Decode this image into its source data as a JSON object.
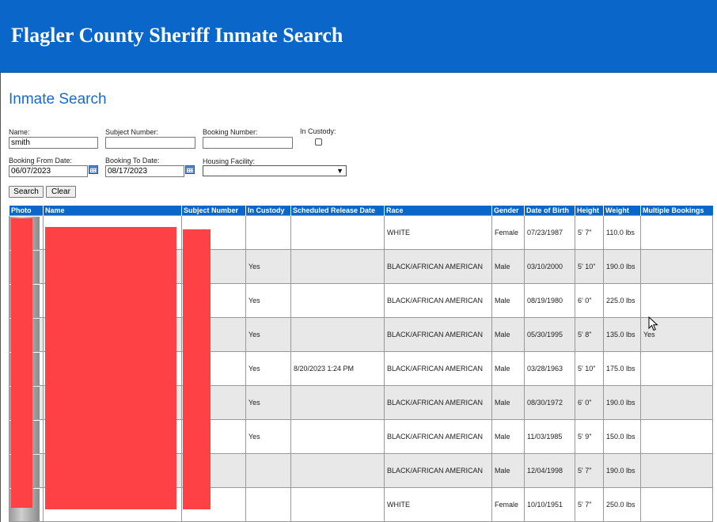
{
  "header": {
    "title": "Flagler County Sheriff Inmate Search"
  },
  "page_title": "Inmate Search",
  "form": {
    "name_label": "Name:",
    "name_value": "smith",
    "subject_label": "Subject Number:",
    "subject_value": "",
    "booking_label": "Booking Number:",
    "booking_value": "",
    "custody_label": "In Custody:",
    "from_label": "Booking From Date:",
    "from_value": "06/07/2023",
    "to_label": "Booking To Date:",
    "to_value": "08/17/2023",
    "housing_label": "Housing Facility:",
    "housing_value": "",
    "search_label": "Search",
    "clear_label": "Clear"
  },
  "table": {
    "columns": [
      "Photo",
      "Name",
      "Subject Number",
      "In Custody",
      "Scheduled Release Date",
      "Race",
      "Gender",
      "Date of Birth",
      "Height",
      "Weight",
      "Multiple Bookings"
    ],
    "rows": [
      {
        "custody": "",
        "release": "",
        "race": "WHITE",
        "gender": "Female",
        "dob": "07/23/1987",
        "height": "5' 7\"",
        "weight": "110.0 lbs",
        "multiple": ""
      },
      {
        "custody": "Yes",
        "release": "",
        "race": "BLACK/AFRICAN AMERICAN",
        "gender": "Male",
        "dob": "03/10/2000",
        "height": "5' 10\"",
        "weight": "190.0 lbs",
        "multiple": ""
      },
      {
        "custody": "Yes",
        "release": "",
        "race": "BLACK/AFRICAN AMERICAN",
        "gender": "Male",
        "dob": "08/19/1980",
        "height": "6' 0\"",
        "weight": "225.0 lbs",
        "multiple": ""
      },
      {
        "custody": "Yes",
        "release": "",
        "race": "BLACK/AFRICAN AMERICAN",
        "gender": "Male",
        "dob": "05/30/1995",
        "height": "5' 8\"",
        "weight": "135.0 lbs",
        "multiple": "Yes"
      },
      {
        "custody": "Yes",
        "release": "8/20/2023 1:24 PM",
        "race": "BLACK/AFRICAN AMERICAN",
        "gender": "Male",
        "dob": "03/28/1963",
        "height": "5' 10\"",
        "weight": "175.0 lbs",
        "multiple": ""
      },
      {
        "custody": "Yes",
        "release": "",
        "race": "BLACK/AFRICAN AMERICAN",
        "gender": "Male",
        "dob": "08/30/1972",
        "height": "6' 0\"",
        "weight": "190.0 lbs",
        "multiple": ""
      },
      {
        "custody": "Yes",
        "release": "",
        "race": "BLACK/AFRICAN AMERICAN",
        "gender": "Male",
        "dob": "11/03/1985",
        "height": "5' 9\"",
        "weight": "150.0 lbs",
        "multiple": ""
      },
      {
        "custody": "",
        "release": "",
        "race": "BLACK/AFRICAN AMERICAN",
        "gender": "Male",
        "dob": "12/04/1998",
        "height": "5' 7\"",
        "weight": "190.0 lbs",
        "multiple": ""
      },
      {
        "custody": "",
        "release": "",
        "race": "WHITE",
        "gender": "Female",
        "dob": "10/10/1951",
        "height": "5' 7\"",
        "weight": "250.0 lbs",
        "multiple": ""
      }
    ]
  }
}
